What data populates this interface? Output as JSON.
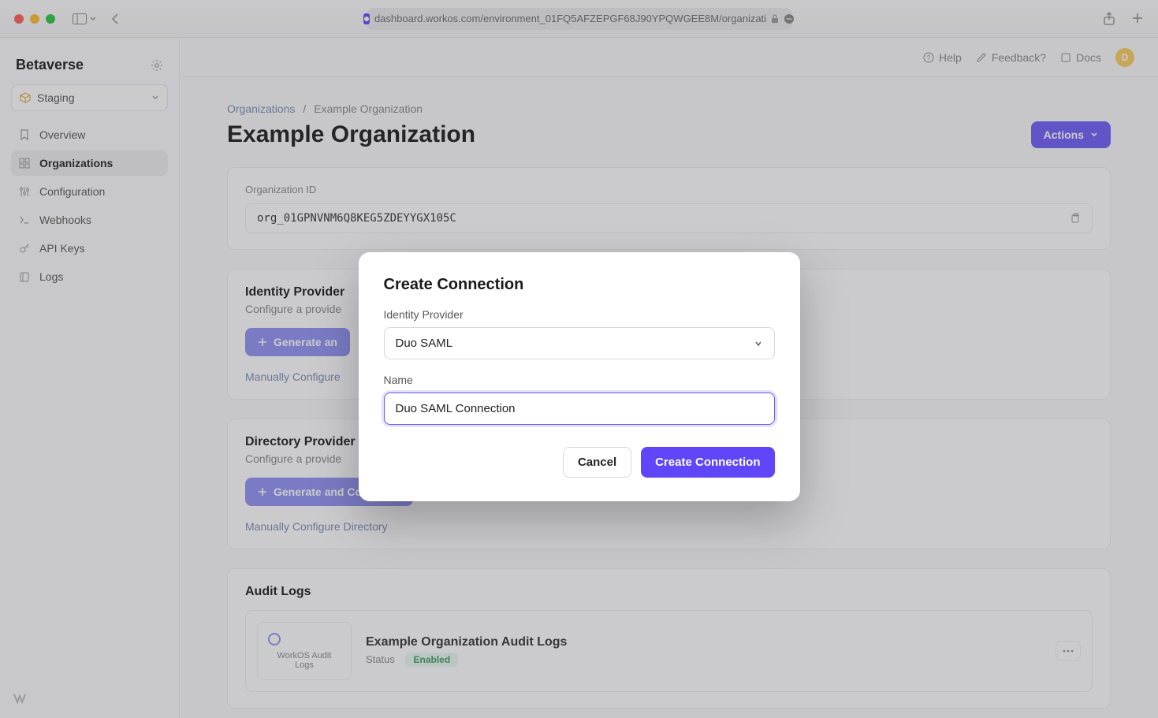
{
  "browser": {
    "url": "dashboard.workos.com/environment_01FQ5AFZEPGF68J90YPQWGEE8M/organizati"
  },
  "workspace": {
    "name": "Betaverse",
    "environment": "Staging"
  },
  "sidebar": {
    "items": [
      {
        "label": "Overview"
      },
      {
        "label": "Organizations"
      },
      {
        "label": "Configuration"
      },
      {
        "label": "Webhooks"
      },
      {
        "label": "API Keys"
      },
      {
        "label": "Logs"
      }
    ]
  },
  "topbar": {
    "help": "Help",
    "feedback": "Feedback?",
    "docs": "Docs",
    "avatar_initial": "D"
  },
  "breadcrumb": {
    "root": "Organizations",
    "current": "Example Organization"
  },
  "page": {
    "title": "Example Organization",
    "actions": "Actions"
  },
  "org_id_card": {
    "label": "Organization ID",
    "value": "org_01GPNVNM6Q8KEG5ZDEYYGX105C"
  },
  "identity": {
    "title": "Identity Provider",
    "subtitle": "Configure a provide",
    "gen": "Generate an",
    "manual": "Manually Configure"
  },
  "directory": {
    "title": "Directory Provider",
    "subtitle": "Configure a provide",
    "gen": "Generate and Copy Link",
    "manual": "Manually Configure Directory"
  },
  "audit": {
    "title": "Audit Logs",
    "badge": "WorkOS Audit Logs",
    "row_title": "Example Organization Audit Logs",
    "status_label": "Status",
    "status": "Enabled"
  },
  "modal": {
    "title": "Create Connection",
    "provider_label": "Identity Provider",
    "provider_value": "Duo SAML",
    "name_label": "Name",
    "name_value": "Duo SAML Connection",
    "cancel": "Cancel",
    "submit": "Create Connection"
  }
}
